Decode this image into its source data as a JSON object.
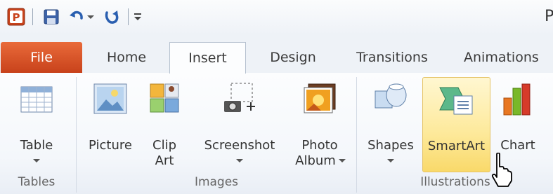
{
  "app": {
    "title_fragment": "P"
  },
  "quick_access": {
    "icons": [
      "powerpoint-logo-icon",
      "save-icon",
      "undo-icon",
      "undo-dropdown-icon",
      "redo-icon",
      "customize-qat-icon"
    ]
  },
  "tabs": [
    {
      "label": "File",
      "active": false
    },
    {
      "label": "Home",
      "active": false
    },
    {
      "label": "Insert",
      "active": true
    },
    {
      "label": "Design",
      "active": false
    },
    {
      "label": "Transitions",
      "active": false
    },
    {
      "label": "Animations",
      "active": false
    }
  ],
  "groups": {
    "tables": {
      "label": "Tables",
      "buttons": [
        {
          "label": "Table",
          "icon": "table-icon",
          "dropdown": true
        }
      ]
    },
    "images": {
      "label": "Images",
      "buttons": [
        {
          "label": "Picture",
          "icon": "picture-icon"
        },
        {
          "label": "Clip",
          "label2": "Art",
          "icon": "clip-art-icon"
        },
        {
          "label": "Screenshot",
          "icon": "screenshot-icon",
          "dropdown": true
        },
        {
          "label": "Photo",
          "label2": "Album",
          "icon": "photo-album-icon",
          "dropdown": true
        }
      ]
    },
    "illustrations": {
      "label": "Illustrations",
      "buttons": [
        {
          "label": "Shapes",
          "icon": "shapes-icon",
          "dropdown": true
        },
        {
          "label": "SmartArt",
          "icon": "smartart-icon",
          "hovered": true
        },
        {
          "label": "Chart",
          "icon": "chart-icon"
        }
      ]
    }
  },
  "colors": {
    "file_tab": "#d2522a",
    "hover": "#fde99a",
    "ribbon_bg": "#f4f7fb"
  }
}
